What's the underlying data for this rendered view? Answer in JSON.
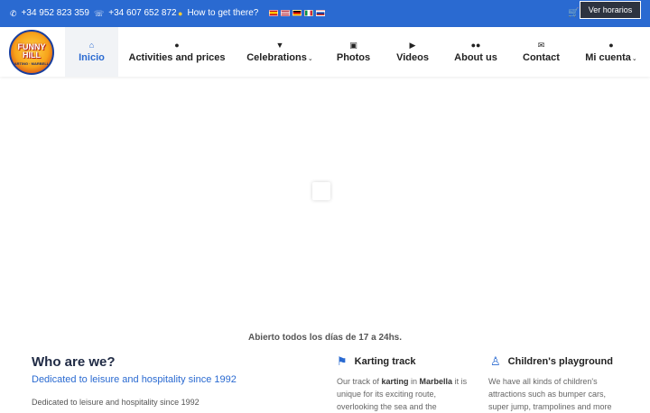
{
  "topbar": {
    "phone1": "+34 952 823 359",
    "phone2": "+34 607 652 872",
    "directions": "How to get there?",
    "hours_button": "Ver horarios",
    "icons": {
      "phone": "phone-icon",
      "whatsapp": "whatsapp-icon",
      "pin": "map-pin-icon",
      "cart": "cart-icon"
    },
    "colors": {
      "bar": "#2a6ad1",
      "button": "#2d3340"
    }
  },
  "logo": {
    "line1": "FUNNY",
    "line2": "HILL",
    "tagline": "KARTING · MARBELLA"
  },
  "nav": {
    "items": [
      {
        "label": "Inicio",
        "icon": "home-icon",
        "active": true
      },
      {
        "label": "Activities and prices",
        "icon": "person-icon"
      },
      {
        "label": "Celebrations",
        "icon": "cocktail-icon",
        "dropdown": true
      },
      {
        "label": "Photos",
        "icon": "image-icon"
      },
      {
        "label": "Videos",
        "icon": "video-camera-icon"
      },
      {
        "label": "About us",
        "icon": "users-icon"
      },
      {
        "label": "Contact",
        "icon": "envelope-icon"
      },
      {
        "label": "Mi cuenta",
        "icon": "user-icon",
        "dropdown": true
      }
    ],
    "active_color": "#2a6ad1"
  },
  "hero": {
    "hours_text": "Abierto todos los días de 17 a 24hs."
  },
  "who": {
    "title": "Who are we?",
    "subtitle": "Dedicated to leisure and hospitality since 1992",
    "text": "Dedicated to leisure and hospitality since 1992"
  },
  "cards": [
    {
      "title": "Karting track",
      "icon": "trophy-icon",
      "text_pre": "Our track of ",
      "text_bold1": "karting",
      "text_mid": " in ",
      "text_bold2": "Marbella",
      "text_post": " it is unique for its exciting route, overlooking the sea and the"
    },
    {
      "title": "Children's playground",
      "icon": "child-icon",
      "text": "We have all kinds of children's attractions such as bumper cars, super jump, trampolines and more"
    }
  ]
}
